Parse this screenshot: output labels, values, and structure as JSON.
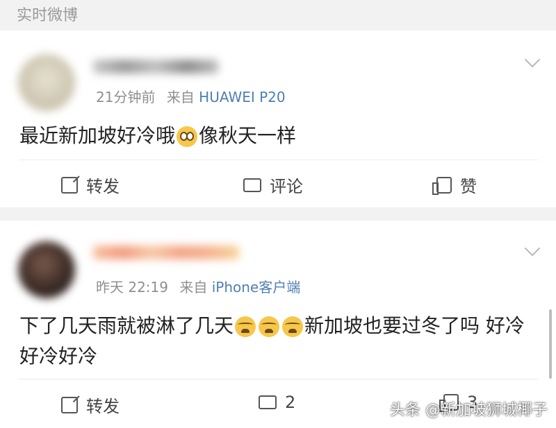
{
  "header": {
    "title": "实时微博"
  },
  "posts": [
    {
      "meta_time": "21分钟前",
      "meta_from": "来自",
      "meta_source": "HUAWEI P20",
      "text_before_emoji": "最近新加坡好冷哦",
      "text_after_emoji": "像秋天一样",
      "actions": {
        "share": "转发",
        "comment": "评论",
        "like": "赞"
      }
    },
    {
      "meta_time": "昨天 22:19",
      "meta_from": "来自",
      "meta_source": "iPhone客户端",
      "text_before_emoji": "下了几天雨就被淋了几天",
      "text_after_emoji": "新加坡也要过冬了吗 好冷好冷好冷",
      "actions": {
        "share": "转发",
        "comment": "2",
        "like": "3"
      }
    }
  ],
  "watermark": "头条 @新加坡狮城椰子",
  "colors": {
    "source_link": "#4f7fb3",
    "background": "#f2f2f2",
    "meta": "#8f8f8f"
  },
  "icons": [
    "chevron-down-icon",
    "share-icon",
    "comment-icon",
    "like-icon",
    "shock-emoji-icon",
    "cry-emoji-icon"
  ]
}
